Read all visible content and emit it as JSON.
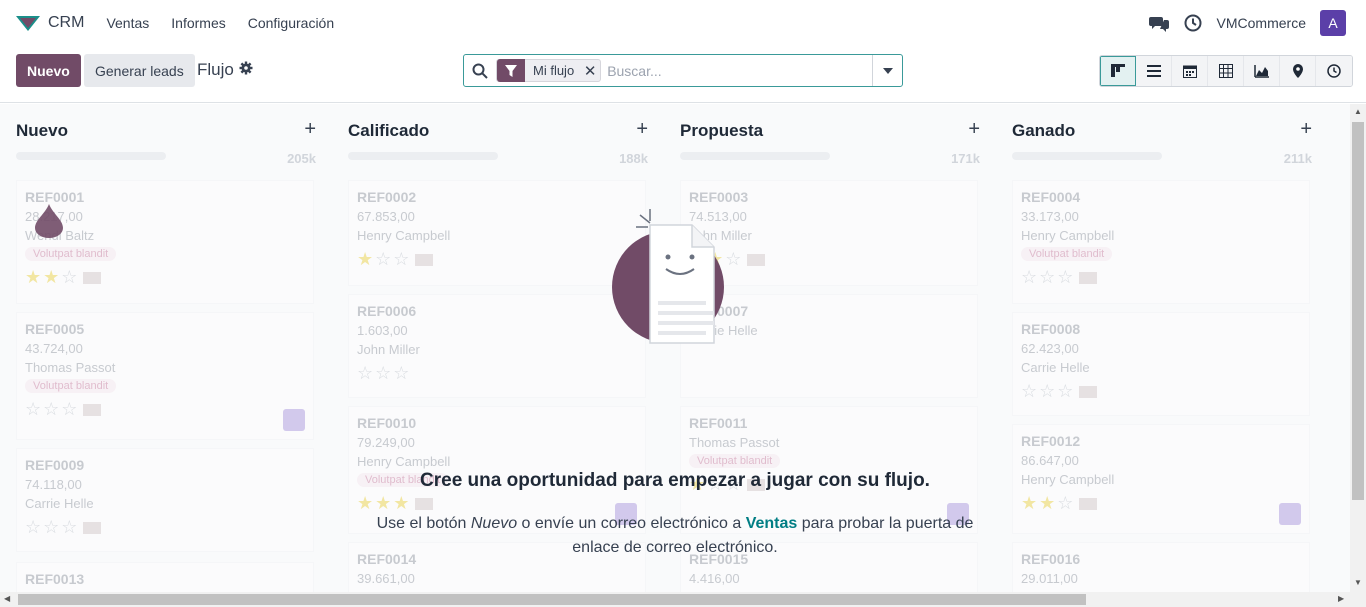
{
  "navbar": {
    "app_name": "CRM",
    "menu": [
      "Ventas",
      "Informes",
      "Configuración"
    ],
    "company": "VMCommerce",
    "user_initial": "A"
  },
  "control": {
    "new_label": "Nuevo",
    "generate_label": "Generar leads",
    "breadcrumb": "Flujo",
    "facet_label": "Mi flujo",
    "search_placeholder": "Buscar..."
  },
  "views": [
    "kanban-icon",
    "list-icon",
    "calendar-icon",
    "pivot-icon",
    "graph-icon",
    "map-pin-icon",
    "activity-icon"
  ],
  "columns": [
    {
      "title": "Nuevo",
      "total": "205k",
      "cards": [
        {
          "ref": "REF0001",
          "amount": "28.217,00",
          "person": "Wendi Baltz",
          "tag": "Volutpat blandit",
          "stars": 2
        },
        {
          "ref": "REF0005",
          "amount": "43.724,00",
          "person": "Thomas Passot",
          "tag": "Volutpat blandit",
          "stars": 0
        },
        {
          "ref": "REF0009",
          "amount": "74.118,00",
          "person": "Carrie Helle",
          "tag": "",
          "stars": 0
        },
        {
          "ref": "REF0013",
          "amount": "",
          "person": "",
          "tag": "",
          "stars": 0
        }
      ]
    },
    {
      "title": "Calificado",
      "total": "188k",
      "cards": [
        {
          "ref": "REF0002",
          "amount": "67.853,00",
          "person": "Henry Campbell",
          "tag": "",
          "stars": 1
        },
        {
          "ref": "REF0006",
          "amount": "1.603,00",
          "person": "John Miller",
          "tag": "",
          "stars": 0
        },
        {
          "ref": "REF0010",
          "amount": "79.249,00",
          "person": "Henry Campbell",
          "tag": "Volutpat blandit",
          "stars": 3
        },
        {
          "ref": "REF0014",
          "amount": "39.661,00",
          "person": "",
          "tag": "",
          "stars": 0
        }
      ]
    },
    {
      "title": "Propuesta",
      "total": "171k",
      "cards": [
        {
          "ref": "REF0003",
          "amount": "74.513,00",
          "person": "John Miller",
          "tag": "",
          "stars": 2
        },
        {
          "ref": "REF0007",
          "amount": "",
          "person": "Carrie Helle",
          "tag": "",
          "stars": 0
        },
        {
          "ref": "REF0011",
          "amount": "",
          "person": "Thomas Passot",
          "tag": "Volutpat blandit",
          "stars": 1
        },
        {
          "ref": "REF0015",
          "amount": "4.416,00",
          "person": "",
          "tag": "",
          "stars": 0
        }
      ]
    },
    {
      "title": "Ganado",
      "total": "211k",
      "cards": [
        {
          "ref": "REF0004",
          "amount": "33.173,00",
          "person": "Henry Campbell",
          "tag": "Volutpat blandit",
          "stars": 0
        },
        {
          "ref": "REF0008",
          "amount": "62.423,00",
          "person": "Carrie Helle",
          "tag": "",
          "stars": 0
        },
        {
          "ref": "REF0012",
          "amount": "86.647,00",
          "person": "Henry Campbell",
          "tag": "",
          "stars": 2
        },
        {
          "ref": "REF0016",
          "amount": "29.011,00",
          "person": "",
          "tag": "",
          "stars": 0
        }
      ]
    }
  ],
  "helper": {
    "title": "Cree una oportunidad para empezar a jugar con su flujo.",
    "body_1": "Use el botón ",
    "body_new": "Nuevo",
    "body_2": " o envíe un correo electrónico a ",
    "body_ventas": "Ventas",
    "body_3": " para probar la puerta de enlace de correo electrónico."
  },
  "colors": {
    "primary": "#714b67",
    "teal": "#017e84"
  }
}
